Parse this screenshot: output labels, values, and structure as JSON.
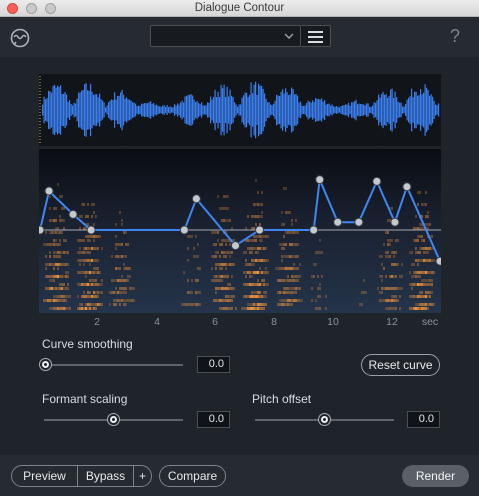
{
  "window": {
    "title": "Dialogue Contour"
  },
  "header": {
    "preset_value": "",
    "logo_icon": "dialogue-contour-logo-icon",
    "help_label": "?"
  },
  "axis": {
    "ticks": [
      "2",
      "4",
      "6",
      "8",
      "10",
      "12"
    ],
    "unit": "sec"
  },
  "controls": {
    "curve_smoothing": {
      "label": "Curve smoothing",
      "value": "0.0",
      "level": 0.0
    },
    "formant_scaling": {
      "label": "Formant scaling",
      "value": "0.0",
      "level": 0.5
    },
    "pitch_offset": {
      "label": "Pitch offset",
      "value": "0.0",
      "level": 0.5
    },
    "reset_curve": "Reset curve"
  },
  "contour": {
    "time_max_sec": 13.3,
    "baseline": 0.0,
    "points": [
      {
        "t": 0.0,
        "v": 0.0
      },
      {
        "t": 0.3,
        "v": 0.65
      },
      {
        "t": 1.1,
        "v": 0.26
      },
      {
        "t": 1.7,
        "v": 0.0
      },
      {
        "t": 4.8,
        "v": 0.0
      },
      {
        "t": 5.2,
        "v": 0.52
      },
      {
        "t": 6.5,
        "v": -0.26
      },
      {
        "t": 7.3,
        "v": 0.0
      },
      {
        "t": 9.1,
        "v": 0.0
      },
      {
        "t": 9.3,
        "v": 0.84
      },
      {
        "t": 9.9,
        "v": 0.13
      },
      {
        "t": 10.6,
        "v": 0.13
      },
      {
        "t": 11.2,
        "v": 0.81
      },
      {
        "t": 11.8,
        "v": 0.13
      },
      {
        "t": 12.2,
        "v": 0.72
      },
      {
        "t": 13.3,
        "v": -0.52
      }
    ]
  },
  "footer": {
    "preview_label": "Preview",
    "bypass_label": "Bypass",
    "plus_label": "+",
    "compare_label": "Compare",
    "render_label": "Render"
  },
  "colors": {
    "accent_blue": "#3f86f2",
    "waveform_blue": "#3a7ff0",
    "spectro_orange": "#f0923a",
    "panel_bg": "#1f242b"
  }
}
